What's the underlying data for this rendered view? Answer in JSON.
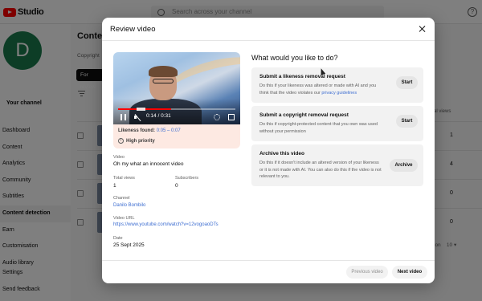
{
  "app": {
    "logo_text": "Studio",
    "search_placeholder": "Search across your channel",
    "help_symbol": "?"
  },
  "sidebar": {
    "avatar_letter": "D",
    "channel_label": "Your channel",
    "items": [
      {
        "label": "Dashboard"
      },
      {
        "label": "Content"
      },
      {
        "label": "Analytics"
      },
      {
        "label": "Community"
      },
      {
        "label": "Subtitles"
      },
      {
        "label": "Content detection"
      },
      {
        "label": "Earn"
      },
      {
        "label": "Customisation"
      },
      {
        "label": "Audio library"
      }
    ],
    "settings_label": "Settings",
    "feedback_label": "Send feedback"
  },
  "background": {
    "title": "Conten",
    "tab_label": "Copyright",
    "chip_label": "For review",
    "filter_prefix": "Fi",
    "column_header": "al views",
    "row_values": [
      "1",
      "4",
      "0",
      "0"
    ],
    "pager_label": "ion",
    "pager_value": "10"
  },
  "modal": {
    "title": "Review video",
    "player": {
      "time": "0:14 / 0:31",
      "progress": 0.45,
      "segment_start": 0.16,
      "segment_end": 0.23
    },
    "likeness": {
      "label": "Likeness found:",
      "range": "0:05 – 0:07",
      "priority": "High priority",
      "info_symbol": "!"
    },
    "video": {
      "label": "Video",
      "title": "Oh my what an innocent video",
      "views_label": "Total views",
      "views": "1",
      "subs_label": "Subscribers",
      "subs": "0",
      "channel_label": "Channel",
      "channel": "Danilo Bombilo",
      "url_label": "Video URL",
      "url": "https://www.youtube.com/watch?v=12vogoaoDTs",
      "date_label": "Date",
      "date": "25 Sept 2025"
    },
    "question": "What would you like to do?",
    "options": [
      {
        "title": "Submit a likeness removal request",
        "desc": "Do this if your likeness was altered or made with AI and you think that the video violates our ",
        "link": "privacy guidelines",
        "button": "Start"
      },
      {
        "title": "Submit a copyright removal request",
        "desc": "Do this if copyright-protected content that you own was used without your permission",
        "button": "Start"
      },
      {
        "title": "Archive this video",
        "desc": "Do this if it doesn't include an altered version of your likeness or it is not made with AI. You can also do this if the video is not relevant to you.",
        "button": "Archive"
      }
    ],
    "prev_label": "Previous video",
    "next_label": "Next video"
  }
}
